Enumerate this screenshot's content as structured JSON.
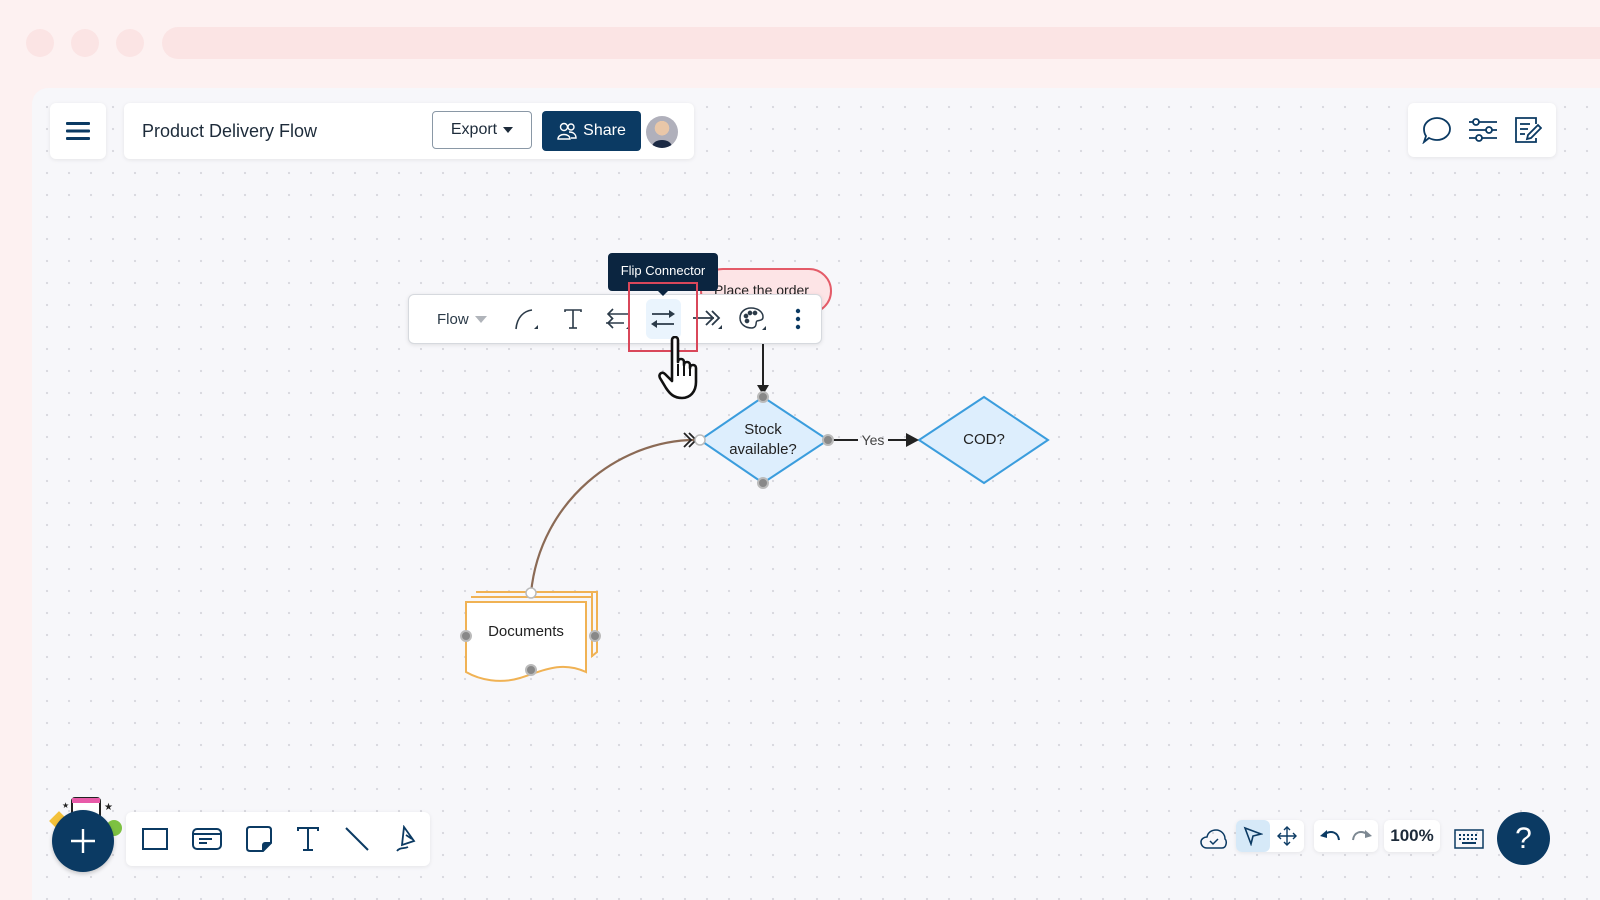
{
  "header": {
    "title": "Product Delivery Flow",
    "export_label": "Export",
    "share_label": "Share",
    "avatar_alt": "user-avatar"
  },
  "right_tools": [
    "comment-icon",
    "settings-sliders-icon",
    "notes-edit-icon"
  ],
  "context_toolbar": {
    "line_style_label": "Flow",
    "tooltip": "Flip Connector",
    "icons": [
      "curve-connector-icon",
      "text-icon",
      "swap-direction-icon",
      "flip-connector-icon",
      "arrowhead-icon",
      "palette-icon",
      "more-vertical-icon"
    ]
  },
  "diagram": {
    "terminator_label": "Place the order",
    "decision_1_label_line1": "Stock",
    "decision_1_label_line2": "available?",
    "decision_2_label": "COD?",
    "edge_label_yes": "Yes",
    "document_label": "Documents",
    "colors": {
      "terminator_fill": "#fde4e6",
      "terminator_stroke": "#e45b68",
      "decision_fill": "#ddeefd",
      "decision_stroke": "#3b9ddd",
      "document_stroke": "#f0b254",
      "connector_curve": "#8b6a55"
    }
  },
  "bottom_toolbar": {
    "tools": [
      "rectangle-icon",
      "card-icon",
      "sticky-note-icon",
      "text-icon",
      "line-icon",
      "pen-icon"
    ]
  },
  "bottom_right": {
    "zoom_level": "100%",
    "help_label": "?"
  },
  "brand": {
    "primary": "#0b3a63",
    "highlight": "#d9475a"
  }
}
